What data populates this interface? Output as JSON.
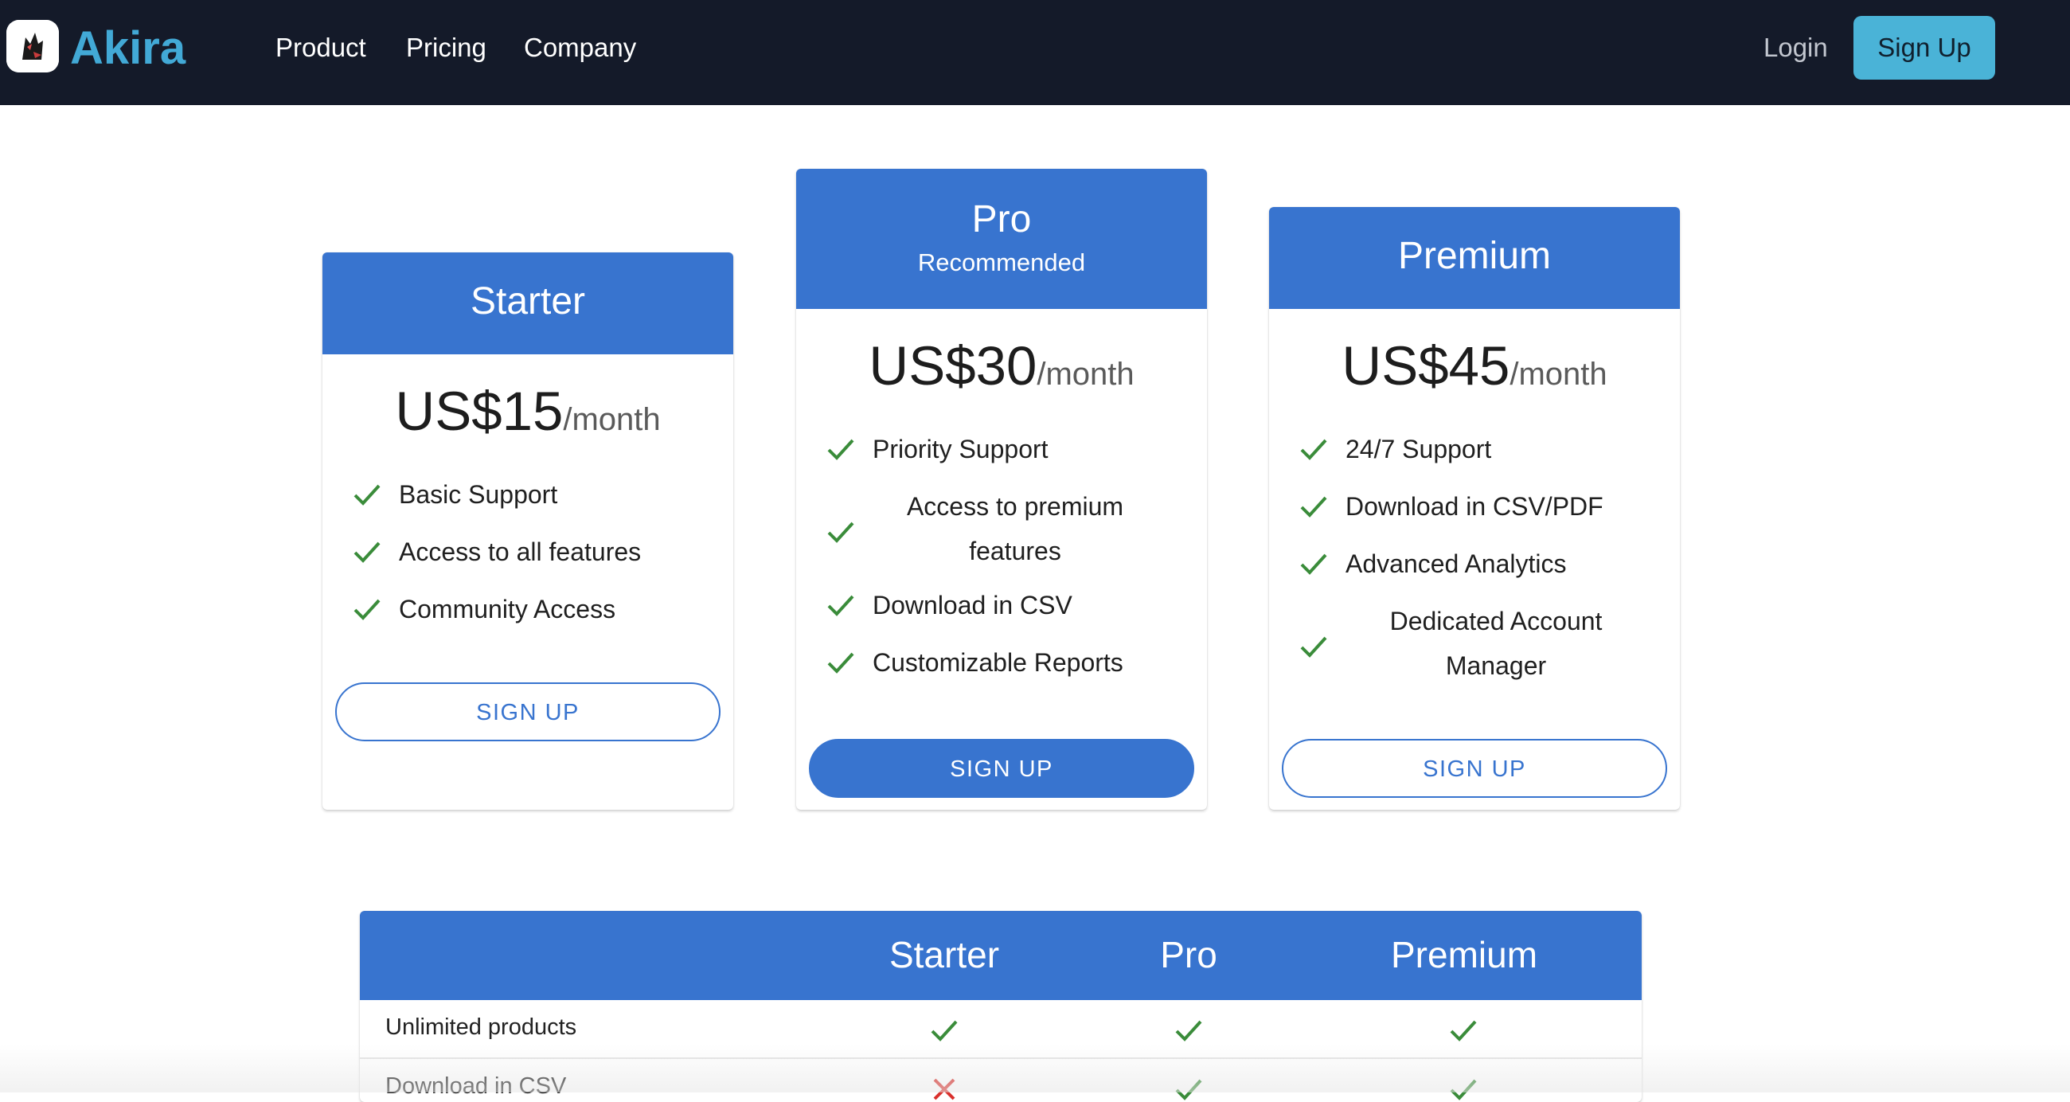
{
  "app": {
    "brand": "Akira",
    "logo_icon": "wolf-logo-icon"
  },
  "nav": {
    "links": [
      "Product",
      "Pricing",
      "Company"
    ],
    "login": "Login",
    "signup": "Sign Up"
  },
  "colors": {
    "navbar_bg": "#141a29",
    "brand": "#42a9d6",
    "accent": "#3874cf",
    "check": "#3a8c3a",
    "cross": "#d9302c"
  },
  "plans": [
    {
      "name": "Starter",
      "subtitle": "",
      "price": "US$15",
      "period": "/month",
      "features": [
        "Basic Support",
        "Access to all features",
        "Community Access"
      ],
      "button": "SIGN UP",
      "button_style": "outline"
    },
    {
      "name": "Pro",
      "subtitle": "Recommended",
      "price": "US$30",
      "period": "/month",
      "features": [
        "Priority Support",
        "Access to premium features",
        "Download in CSV",
        "Customizable Reports"
      ],
      "button": "SIGN UP",
      "button_style": "solid"
    },
    {
      "name": "Premium",
      "subtitle": "",
      "price": "US$45",
      "period": "/month",
      "features": [
        "24/7 Support",
        "Download in CSV/PDF",
        "Advanced Analytics",
        "Dedicated Account Manager"
      ],
      "button": "SIGN UP",
      "button_style": "outline"
    }
  ],
  "comparison": {
    "columns": [
      "",
      "Starter",
      "Pro",
      "Premium"
    ],
    "rows": [
      {
        "label": "Unlimited products",
        "values": [
          "check",
          "check",
          "check"
        ]
      },
      {
        "label": "Download in CSV",
        "values": [
          "cross",
          "check",
          "check"
        ]
      }
    ]
  }
}
